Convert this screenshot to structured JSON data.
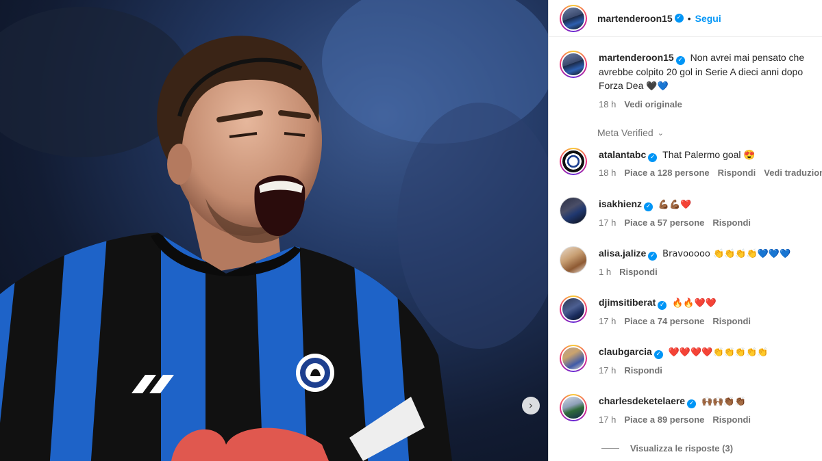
{
  "post": {
    "author": "martenderoon15",
    "follow_label": "Segui",
    "separator": "•",
    "caption_lines": [
      "Non avrei mai pensato che",
      "avrebbe colpito 20 gol in Serie A dieci anni dopo",
      "Forza Dea"
    ],
    "caption_hearts": [
      "🖤",
      "💙"
    ],
    "time": "18 h",
    "see_original": "Vedi originale",
    "meta_verified": "Meta Verified"
  },
  "comments": [
    {
      "user": "atalantabc",
      "text": "That Palermo goal 😍",
      "time": "18 h",
      "likes": "Piace a 128 persone",
      "reply": "Rispondi",
      "translate": "Vedi traduzione"
    },
    {
      "user": "isakhienz",
      "text": "💪🏾💪🏾❤️",
      "time": "17 h",
      "likes": "Piace a 57 persone",
      "reply": "Rispondi"
    },
    {
      "user": "alisa.jalize",
      "text": "Bravooooo 👏👏👏👏💙💙💙",
      "time": "1 h",
      "reply": "Rispondi"
    },
    {
      "user": "djimsitiberat",
      "text": "🔥🔥❤️❤️",
      "time": "17 h",
      "likes": "Piace a 74 persone",
      "reply": "Rispondi"
    },
    {
      "user": "claubgarcia",
      "text": "❤️❤️❤️❤️👏👏👏👏👏",
      "time": "17 h",
      "reply": "Rispondi"
    },
    {
      "user": "charlesdeketelaere",
      "text": "🙌🏾🙌🏾👏🏾👏🏾",
      "time": "17 h",
      "likes": "Piace a 89 persone",
      "reply": "Rispondi"
    }
  ],
  "view_replies": "Visualizza le risposte (3)",
  "icons": {
    "verified": "verified-badge-icon",
    "carousel": "chevron-right-icon",
    "meta_verified": "chevron-down-icon"
  },
  "colors": {
    "link": "#0095f6",
    "secondary_text": "#737373",
    "jersey_blue": "#1e63c8",
    "jersey_black": "#111111"
  }
}
